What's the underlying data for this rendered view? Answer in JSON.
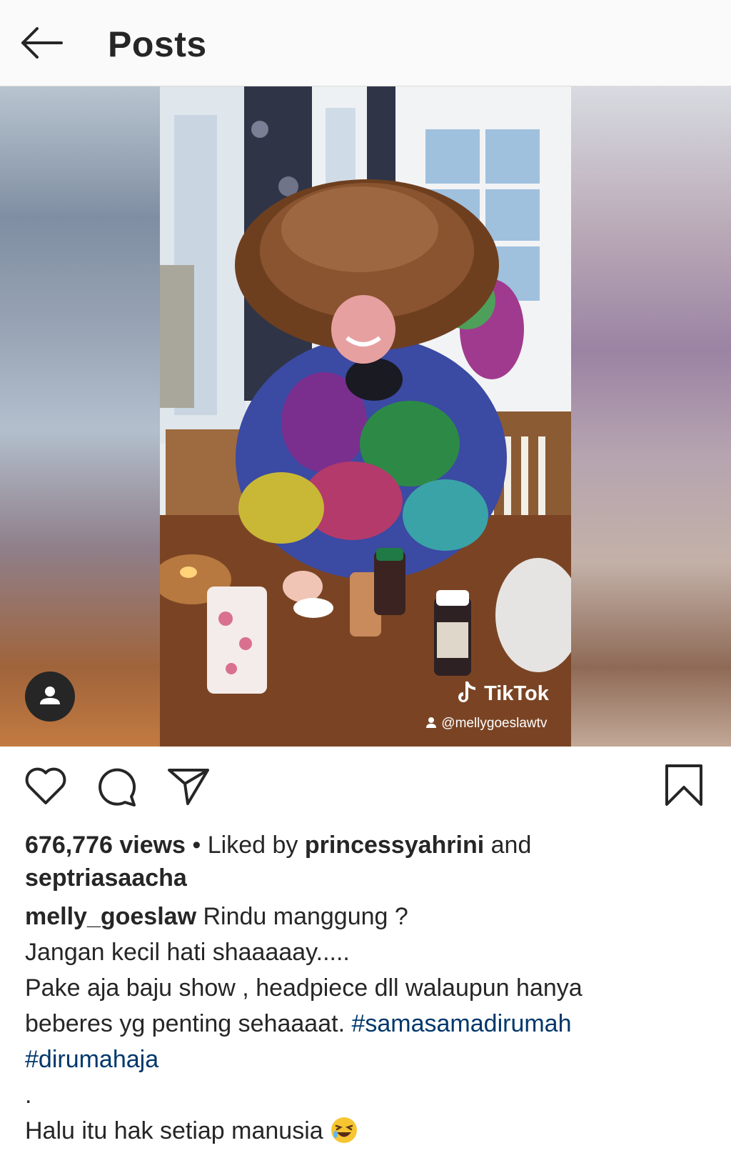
{
  "header": {
    "title": "Posts",
    "back_icon": "arrow-left-icon"
  },
  "media": {
    "tiktok_logo": "TikTok",
    "tiktok_handle": "@mellygoeslawtv",
    "user_tag_icon": "person-icon"
  },
  "actions": {
    "like_icon": "heart-icon",
    "comment_icon": "comment-icon",
    "share_icon": "paper-plane-icon",
    "save_icon": "bookmark-icon"
  },
  "stats": {
    "views": "676,776 views",
    "separator": " • ",
    "liked_by_prefix": "Liked by ",
    "liked_user_1": "princessyahrini",
    "and_text": " and",
    "liked_user_2": "septriasaacha"
  },
  "caption": {
    "author": "melly_goeslaw",
    "line1": " Rindu manggung ?",
    "line2": "Jangan kecil hati shaaaaay.....",
    "line3": "Pake aja baju show , headpiece dll walaupun hanya",
    "line4": "beberes yg penting sehaaaat. ",
    "hashtag1": "#samasamadirumah",
    "hashtag2": "#dirumahaja",
    "dot": ".",
    "line6": "Halu itu hak setiap manusia ",
    "emoji_icon": "rolling-on-the-floor-laughing-emoji"
  },
  "colors": {
    "text": "#262626",
    "hashtag": "#00376b",
    "header_bg": "#fafafa"
  }
}
